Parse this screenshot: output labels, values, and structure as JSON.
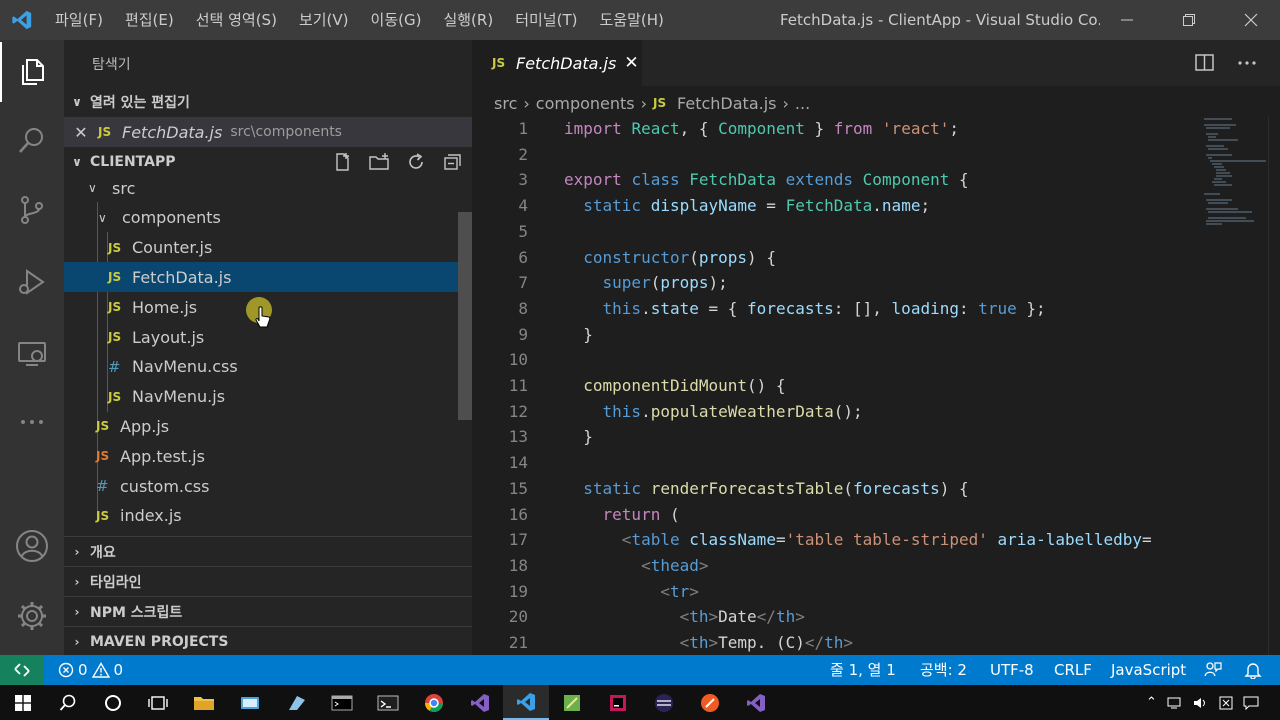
{
  "titlebar": {
    "menu": [
      "파일(F)",
      "편집(E)",
      "선택 영역(S)",
      "보기(V)",
      "이동(G)",
      "실행(R)",
      "터미널(T)",
      "도움말(H)"
    ],
    "window_title": "FetchData.js - ClientApp - Visual Studio Co..."
  },
  "sidebar": {
    "title": "탐색기",
    "open_editors": {
      "header": "열려 있는 편집기",
      "file_icon": "JS",
      "file_name": "FetchData.js",
      "file_path": "src\\components"
    },
    "project_header": "CLIENTAPP",
    "tree": [
      {
        "label": "src",
        "kind": "folder",
        "icon": ""
      },
      {
        "label": "components",
        "kind": "folder",
        "icon": ""
      },
      {
        "label": "Counter.js",
        "kind": "file",
        "icon": "JS"
      },
      {
        "label": "FetchData.js",
        "kind": "file",
        "icon": "JS",
        "selected": true
      },
      {
        "label": "Home.js",
        "kind": "file",
        "icon": "JS"
      },
      {
        "label": "Layout.js",
        "kind": "file",
        "icon": "JS"
      },
      {
        "label": "NavMenu.css",
        "kind": "file",
        "icon": "#"
      },
      {
        "label": "NavMenu.js",
        "kind": "file",
        "icon": "JS"
      },
      {
        "label": "App.js",
        "kind": "file",
        "icon": "JS"
      },
      {
        "label": "App.test.js",
        "kind": "file",
        "icon": "JS"
      },
      {
        "label": "custom.css",
        "kind": "file",
        "icon": "#"
      },
      {
        "label": "index.js",
        "kind": "file",
        "icon": "JS"
      }
    ],
    "sections": [
      "개요",
      "타임라인",
      "NPM 스크립트",
      "MAVEN PROJECTS"
    ]
  },
  "editor": {
    "tab_icon": "JS",
    "tab_label": "FetchData.js",
    "breadcrumb": [
      "src",
      "components",
      "FetchData.js",
      "..."
    ],
    "breadcrumb_icon": "JS",
    "lines": [
      [
        [
          "kw",
          "import"
        ],
        [
          "t",
          " "
        ],
        [
          "cls",
          "React"
        ],
        [
          "t",
          ", { "
        ],
        [
          "cls",
          "Component"
        ],
        [
          "t",
          " } "
        ],
        [
          "kw",
          "from"
        ],
        [
          "t",
          " "
        ],
        [
          "str",
          "'react'"
        ],
        [
          "t",
          ";"
        ]
      ],
      [],
      [
        [
          "kw",
          "export"
        ],
        [
          "t",
          " "
        ],
        [
          "kw2",
          "class"
        ],
        [
          "t",
          " "
        ],
        [
          "cls",
          "FetchData"
        ],
        [
          "t",
          " "
        ],
        [
          "kw2",
          "extends"
        ],
        [
          "t",
          " "
        ],
        [
          "cls",
          "Component"
        ],
        [
          "t",
          " {"
        ]
      ],
      [
        [
          "t",
          "  "
        ],
        [
          "kw2",
          "static"
        ],
        [
          "t",
          " "
        ],
        [
          "var",
          "displayName"
        ],
        [
          "t",
          " = "
        ],
        [
          "cls",
          "FetchData"
        ],
        [
          "t",
          "."
        ],
        [
          "var",
          "name"
        ],
        [
          "t",
          ";"
        ]
      ],
      [],
      [
        [
          "t",
          "  "
        ],
        [
          "kw2",
          "constructor"
        ],
        [
          "t",
          "("
        ],
        [
          "var",
          "props"
        ],
        [
          "t",
          ") {"
        ]
      ],
      [
        [
          "t",
          "    "
        ],
        [
          "kw2",
          "super"
        ],
        [
          "t",
          "("
        ],
        [
          "var",
          "props"
        ],
        [
          "t",
          ");"
        ]
      ],
      [
        [
          "t",
          "    "
        ],
        [
          "kw2",
          "this"
        ],
        [
          "t",
          "."
        ],
        [
          "var",
          "state"
        ],
        [
          "t",
          " = { "
        ],
        [
          "var",
          "forecasts"
        ],
        [
          "t",
          ": [], "
        ],
        [
          "var",
          "loading"
        ],
        [
          "t",
          ": "
        ],
        [
          "kw2",
          "true"
        ],
        [
          "t",
          " };"
        ]
      ],
      [
        [
          "t",
          "  }"
        ]
      ],
      [],
      [
        [
          "t",
          "  "
        ],
        [
          "fn",
          "componentDidMount"
        ],
        [
          "t",
          "() {"
        ]
      ],
      [
        [
          "t",
          "    "
        ],
        [
          "kw2",
          "this"
        ],
        [
          "t",
          "."
        ],
        [
          "fn",
          "populateWeatherData"
        ],
        [
          "t",
          "();"
        ]
      ],
      [
        [
          "t",
          "  }"
        ]
      ],
      [],
      [
        [
          "t",
          "  "
        ],
        [
          "kw2",
          "static"
        ],
        [
          "t",
          " "
        ],
        [
          "fn",
          "renderForecastsTable"
        ],
        [
          "t",
          "("
        ],
        [
          "var",
          "forecasts"
        ],
        [
          "t",
          ") {"
        ]
      ],
      [
        [
          "t",
          "    "
        ],
        [
          "kw",
          "return"
        ],
        [
          "t",
          " ("
        ]
      ],
      [
        [
          "t",
          "      "
        ],
        [
          "tagp",
          "<"
        ],
        [
          "tag",
          "table"
        ],
        [
          "t",
          " "
        ],
        [
          "attr",
          "className"
        ],
        [
          "t",
          "="
        ],
        [
          "str",
          "'table table-striped'"
        ],
        [
          "t",
          " "
        ],
        [
          "attr",
          "aria-labelledby"
        ],
        [
          "t",
          "="
        ]
      ],
      [
        [
          "t",
          "        "
        ],
        [
          "tagp",
          "<"
        ],
        [
          "tag",
          "thead"
        ],
        [
          "tagp",
          ">"
        ]
      ],
      [
        [
          "t",
          "          "
        ],
        [
          "tagp",
          "<"
        ],
        [
          "tag",
          "tr"
        ],
        [
          "tagp",
          ">"
        ]
      ],
      [
        [
          "t",
          "            "
        ],
        [
          "tagp",
          "<"
        ],
        [
          "tag",
          "th"
        ],
        [
          "tagp",
          ">"
        ],
        [
          "t",
          "Date"
        ],
        [
          "tagp",
          "</"
        ],
        [
          "tag",
          "th"
        ],
        [
          "tagp",
          ">"
        ]
      ],
      [
        [
          "t",
          "            "
        ],
        [
          "tagp",
          "<"
        ],
        [
          "tag",
          "th"
        ],
        [
          "tagp",
          ">"
        ],
        [
          "t",
          "Temp. (C)"
        ],
        [
          "tagp",
          "</"
        ],
        [
          "tag",
          "th"
        ],
        [
          "tagp",
          ">"
        ]
      ]
    ]
  },
  "statusbar": {
    "errors": "0",
    "warnings": "0",
    "position": "줄 1, 열 1",
    "indent": "공백: 2",
    "encoding": "UTF-8",
    "eol": "CRLF",
    "language": "JavaScript"
  },
  "colors": {
    "kw": "#c586c0",
    "kw2": "#569cd6",
    "cls": "#4ec9b0",
    "str": "#ce9178",
    "var": "#9cdcfe",
    "fn": "#dcdcaa",
    "tag": "#569cd6",
    "tagp": "#808080",
    "attr": "#9cdcfe",
    "t": "#d4d4d4",
    "accent": "#007acc",
    "selection": "#094771"
  }
}
